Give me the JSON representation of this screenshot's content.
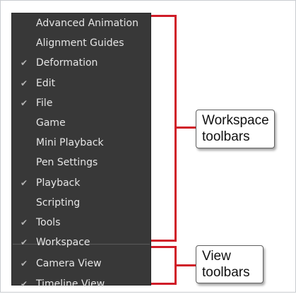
{
  "menu": {
    "items": [
      {
        "label": "Advanced Animation",
        "checked": false
      },
      {
        "label": "Alignment Guides",
        "checked": false
      },
      {
        "label": "Deformation",
        "checked": true
      },
      {
        "label": "Edit",
        "checked": true
      },
      {
        "label": "File",
        "checked": true
      },
      {
        "label": "Game",
        "checked": false
      },
      {
        "label": "Mini Playback",
        "checked": false
      },
      {
        "label": "Pen Settings",
        "checked": false
      },
      {
        "label": "Playback",
        "checked": true
      },
      {
        "label": "Scripting",
        "checked": false
      },
      {
        "label": "Tools",
        "checked": true
      },
      {
        "label": "Workspace",
        "checked": true
      },
      {
        "label": "Camera View",
        "checked": true
      },
      {
        "label": "Timeline View",
        "checked": true
      }
    ],
    "check_glyph": "✔"
  },
  "callouts": {
    "workspace": {
      "line1": "Workspace",
      "line2": "toolbars"
    },
    "view": {
      "line1": "View",
      "line2": "toolbars"
    }
  },
  "colors": {
    "menu_background": "#383838",
    "menu_text": "#e6e6e6",
    "annotation_red": "#d01c28"
  }
}
